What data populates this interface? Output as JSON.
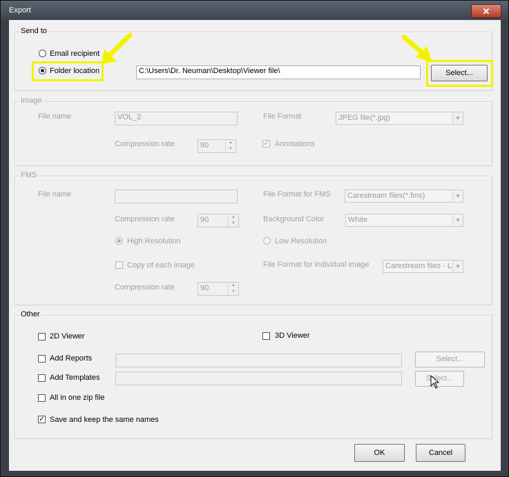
{
  "window": {
    "title": "Export",
    "close_glyph": "✕"
  },
  "send_to": {
    "label": "Send to",
    "email_label": "Email recipient",
    "folder_label": "Folder location",
    "path_value": "C:\\Users\\Dr. Neuman\\Desktop\\Viewer file\\",
    "select_label": "Select..."
  },
  "image": {
    "label": "Image",
    "file_name_label": "File name",
    "file_name_value": "VOL_2",
    "file_format_label": "File Format",
    "file_format_value": "JPEG file(*.jpg)",
    "compression_label": "Compression rate",
    "compression_value": "90",
    "annotations_label": "Annotations"
  },
  "fms": {
    "label": "FMS",
    "file_name_label": "File name",
    "file_name_value": "",
    "format_label": "File Format for FMS",
    "format_value": "Carestream files(*.fms)",
    "compression_label": "Compression rate",
    "compression_value": "90",
    "bg_label": "Background Color",
    "bg_value": "White",
    "high_res_label": "High Resolution",
    "low_res_label": "Low Resolution",
    "copy_label": "Copy of each image",
    "individual_format_label": "File Format for individual image",
    "individual_format_value": "Carestream files - Lar",
    "compression2_label": "Compression rate",
    "compression2_value": "90"
  },
  "other": {
    "label": "Other",
    "viewer2d_label": "2D Viewer",
    "viewer3d_label": "3D Viewer",
    "reports_label": "Add Reports",
    "templates_label": "Add Templates",
    "zip_label": "All in one zip file",
    "save_names_label": "Save and keep the same names",
    "select_reports_label": "Select...",
    "select_templates_label": "Select..."
  },
  "footer": {
    "ok_label": "OK",
    "cancel_label": "Cancel"
  },
  "colors": {
    "highlight": "#f2f200",
    "title_bar": "#3d444d",
    "dialog_bg": "#f0f0f0"
  },
  "icons": [
    "close-icon",
    "arrow-pointer-icon",
    "mouse-cursor-icon",
    "chevron-down-icon"
  ]
}
